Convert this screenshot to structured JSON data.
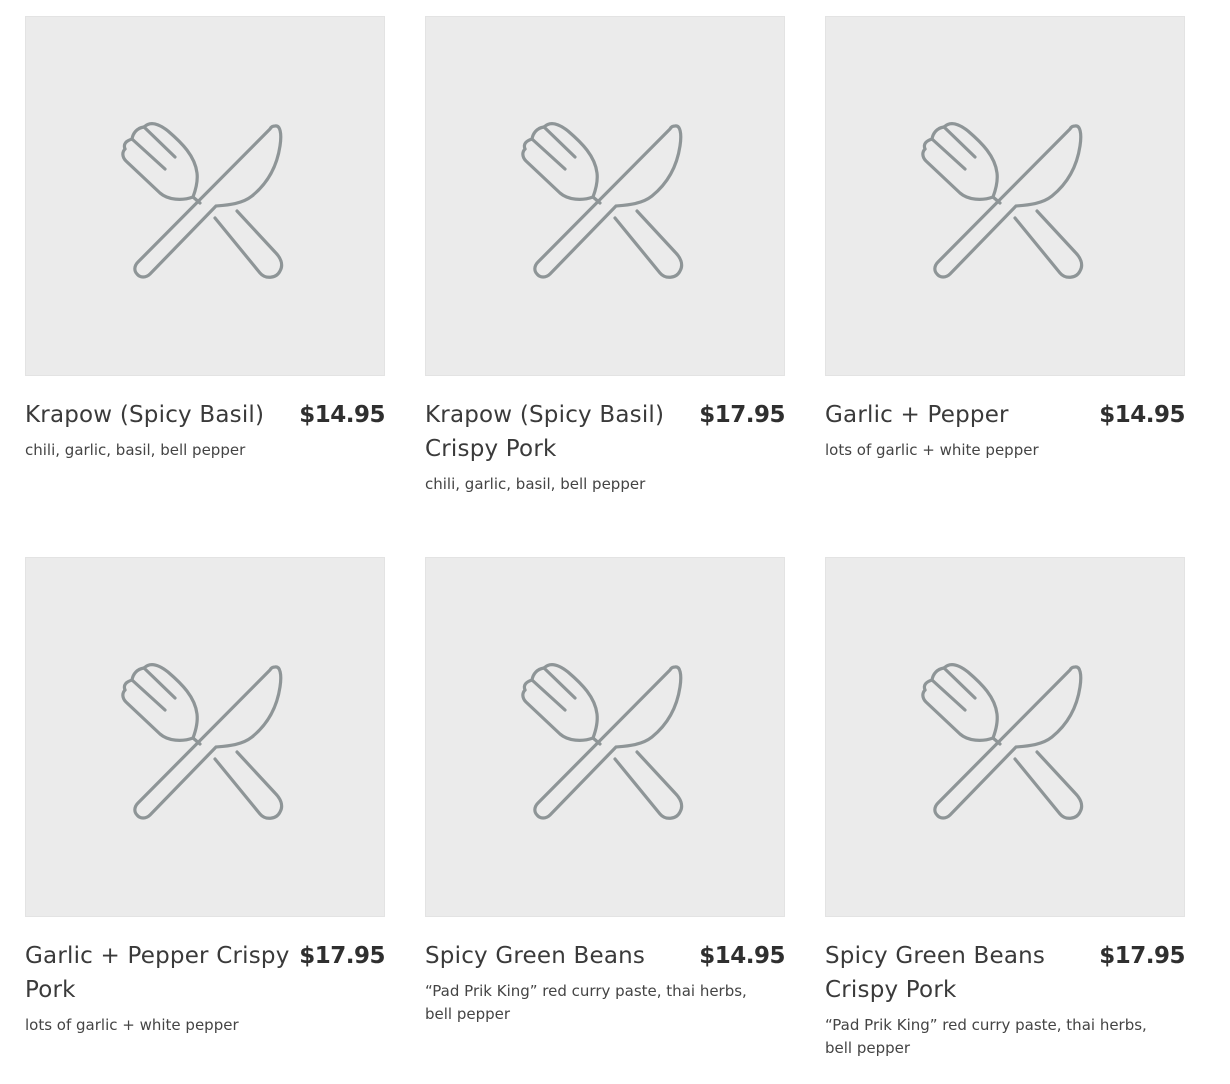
{
  "menu_items": [
    {
      "name": "Krapow (Spicy Basil)",
      "price": "$14.95",
      "description": "chili, garlic, basil, bell pepper",
      "image_icon": "utensils-icon"
    },
    {
      "name": "Krapow (Spicy Basil) Crispy Pork",
      "price": "$17.95",
      "description": "chili, garlic, basil, bell pepper",
      "image_icon": "utensils-icon"
    },
    {
      "name": "Garlic + Pepper",
      "price": "$14.95",
      "description": "lots of garlic + white pepper",
      "image_icon": "utensils-icon"
    },
    {
      "name": "Garlic + Pepper Crispy Pork",
      "price": "$17.95",
      "description": "lots of garlic + white pepper",
      "image_icon": "utensils-icon"
    },
    {
      "name": "Spicy Green Beans",
      "price": "$14.95",
      "description": "“Pad Prik King” red curry paste, thai herbs, bell pepper",
      "image_icon": "utensils-icon"
    },
    {
      "name": "Spicy Green Beans Crispy Pork",
      "price": "$17.95",
      "description": "“Pad Prik King” red curry paste, thai herbs, bell pepper",
      "image_icon": "utensils-icon"
    }
  ],
  "colors": {
    "placeholder_bg": "#ebebeb",
    "icon_stroke": "#8e9597",
    "text": "#3a3a3a"
  }
}
